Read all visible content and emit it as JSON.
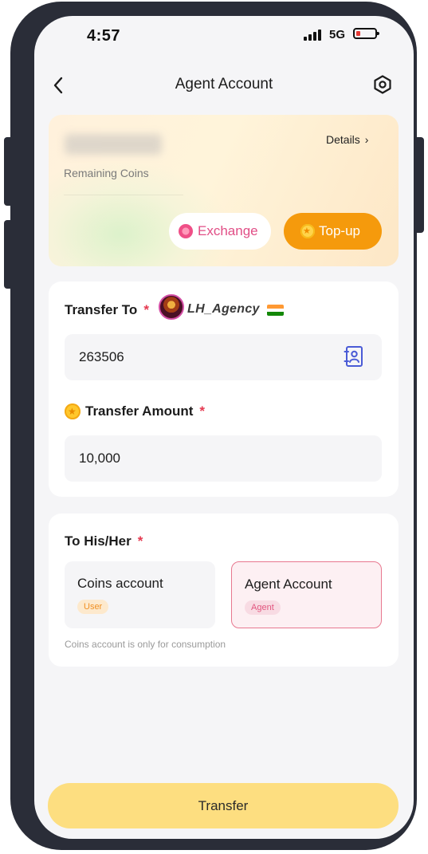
{
  "status_bar": {
    "time": "4:57",
    "network": "5G"
  },
  "nav": {
    "title": "Agent Account",
    "back_icon": "chevron-left-icon",
    "settings_icon": "settings-hexagon-icon"
  },
  "balance": {
    "amount_hidden": true,
    "label": "Remaining Coins",
    "details_label": "Details",
    "exchange_label": "Exchange",
    "topup_label": "Top-up"
  },
  "transfer": {
    "to_label": "Transfer To",
    "required_mark": "*",
    "agency_name": "LH_Agency",
    "recipient_id": "263506",
    "amount_label": "Transfer Amount",
    "amount_value": "10,000"
  },
  "recipient": {
    "label": "To His/Her",
    "options": [
      {
        "title": "Coins account",
        "tag": "User",
        "selected": false
      },
      {
        "title": "Agent Account",
        "tag": "Agent",
        "selected": true
      }
    ],
    "note": "Coins account is only for consumption"
  },
  "action": {
    "transfer_label": "Transfer"
  },
  "colors": {
    "accent_orange": "#f59a0c",
    "exchange_pink": "#e14e86",
    "required_red": "#e53950",
    "selected_border": "#e8788f",
    "transfer_button": "#fdde80"
  }
}
